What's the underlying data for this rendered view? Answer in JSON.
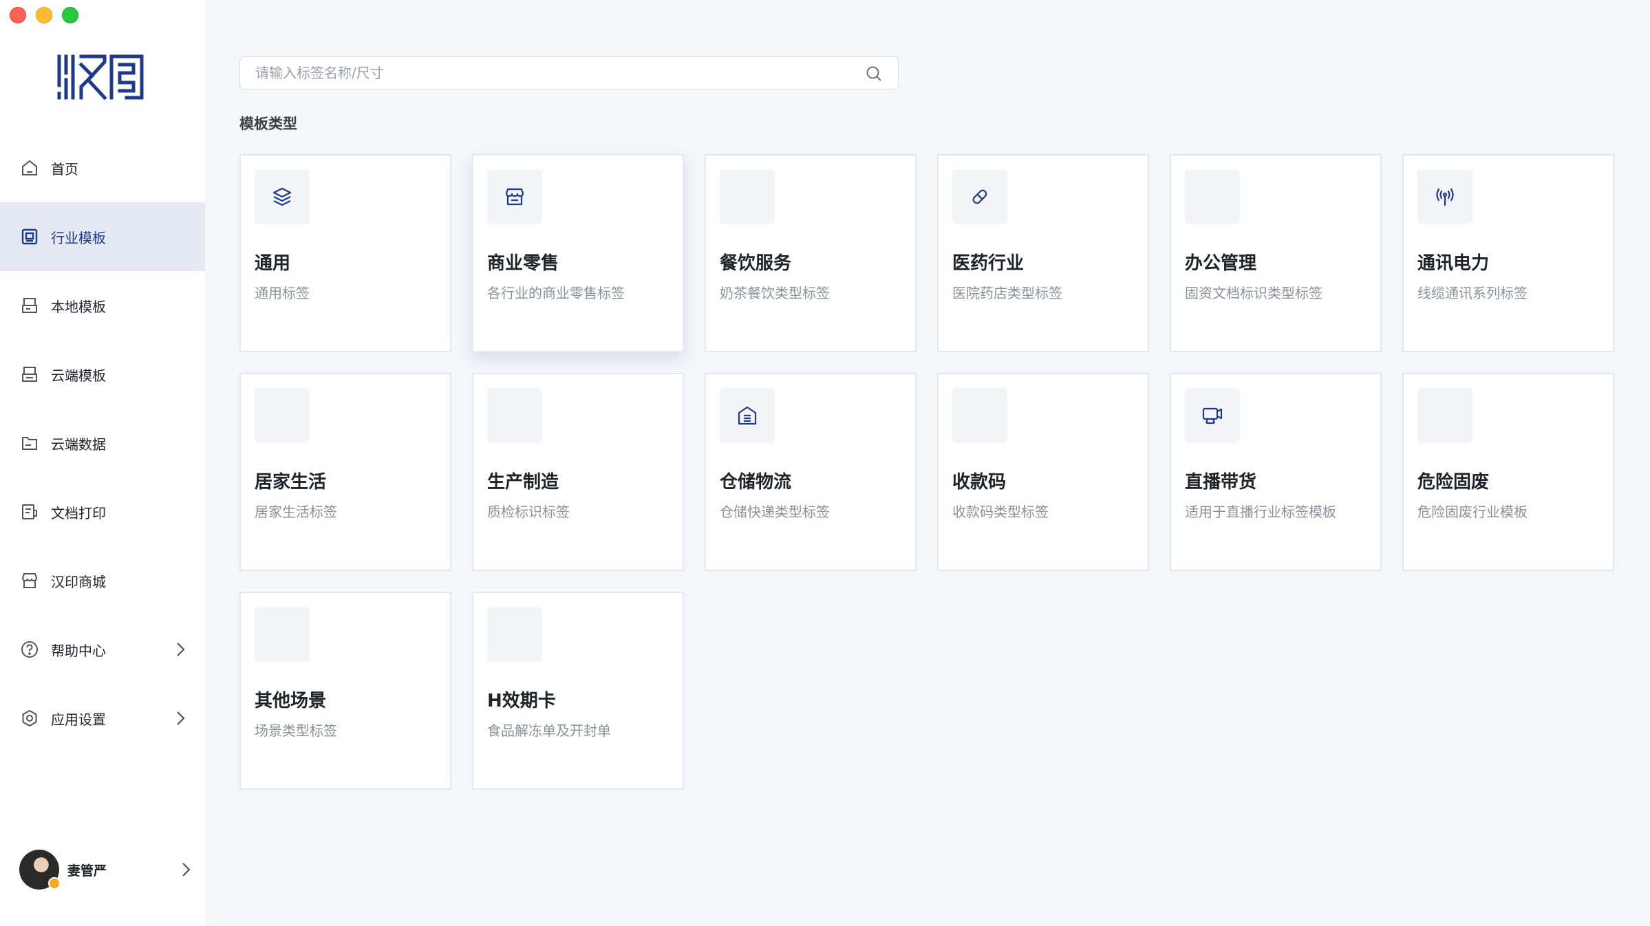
{
  "window": {
    "controls": [
      "close",
      "minimize",
      "zoom"
    ]
  },
  "colors": {
    "accent": "#1e3a8a",
    "active_bg": "#e4e8f2",
    "page_bg": "#f5f6fa"
  },
  "sidebar": {
    "logo_icon": "hanma-logo",
    "items": [
      {
        "label": "首页",
        "icon": "home-icon"
      },
      {
        "label": "行业模板",
        "icon": "template-icon",
        "active": true
      },
      {
        "label": "本地模板",
        "icon": "local-template-icon"
      },
      {
        "label": "云端模板",
        "icon": "cloud-template-icon"
      },
      {
        "label": "云端数据",
        "icon": "cloud-data-icon"
      },
      {
        "label": "文档打印",
        "icon": "document-print-icon"
      },
      {
        "label": "汉印商城",
        "icon": "store-icon"
      },
      {
        "label": "帮助中心",
        "icon": "help-icon",
        "has_submenu": true
      },
      {
        "label": "应用设置",
        "icon": "settings-icon",
        "has_submenu": true
      }
    ],
    "user": {
      "name": "妻管严"
    }
  },
  "search": {
    "placeholder": "请输入标签名称/尺寸",
    "value": ""
  },
  "section": {
    "title": "模板类型"
  },
  "cards": [
    {
      "title": "通用",
      "desc": "通用标签",
      "icon": "layers-icon"
    },
    {
      "title": "商业零售",
      "desc": "各行业的商业零售标签",
      "icon": "shop-icon"
    },
    {
      "title": "餐饮服务",
      "desc": "奶茶餐饮类型标签",
      "icon": ""
    },
    {
      "title": "医药行业",
      "desc": "医院药店类型标签",
      "icon": "pill-icon"
    },
    {
      "title": "办公管理",
      "desc": "固资文档标识类型标签",
      "icon": ""
    },
    {
      "title": "通讯电力",
      "desc": "线缆通讯系列标签",
      "icon": "antenna-icon"
    },
    {
      "title": "居家生活",
      "desc": "居家生活标签",
      "icon": ""
    },
    {
      "title": "生产制造",
      "desc": "质检标识标签",
      "icon": ""
    },
    {
      "title": "仓储物流",
      "desc": "仓储快递类型标签",
      "icon": "warehouse-icon"
    },
    {
      "title": "收款码",
      "desc": "收款码类型标签",
      "icon": ""
    },
    {
      "title": "直播带货",
      "desc": "适用于直播行业标签模板",
      "icon": "live-stream-icon"
    },
    {
      "title": "危险固废",
      "desc": "危险固废行业模板",
      "icon": ""
    },
    {
      "title": "其他场景",
      "desc": "场景类型标签",
      "icon": ""
    },
    {
      "title": "H效期卡",
      "desc": "食品解冻单及开封单",
      "icon": ""
    }
  ]
}
